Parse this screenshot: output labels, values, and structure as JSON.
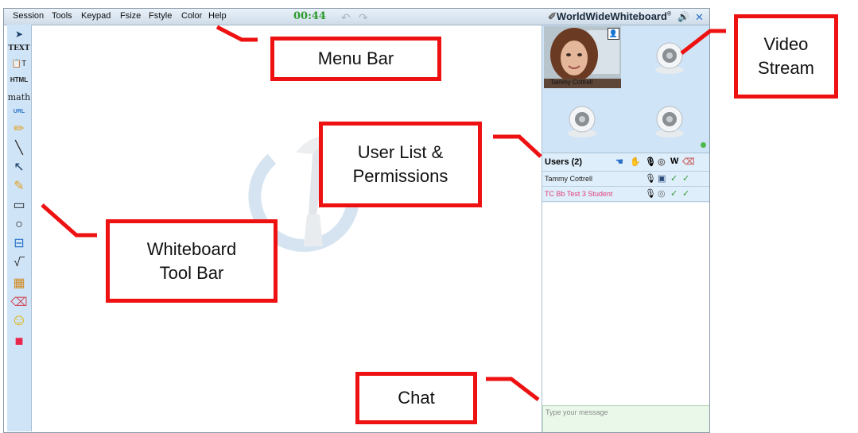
{
  "menu": {
    "items": [
      "Session",
      "Tools",
      "Keypad",
      "Fsize",
      "Fstyle",
      "Color",
      "Help"
    ],
    "timer": "00:44"
  },
  "brand": {
    "name": "WorldWideWhiteboard",
    "trademark": "®"
  },
  "toolbar": {
    "tools": [
      {
        "icon": "pointer-icon",
        "label": "➤"
      },
      {
        "icon": "text-tool-icon",
        "label": "TEXT"
      },
      {
        "icon": "paste-text-icon",
        "label": "📋T"
      },
      {
        "icon": "html-tool-icon",
        "label": "HTML"
      },
      {
        "icon": "math-tool-icon",
        "label": "math"
      },
      {
        "icon": "url-tool-icon",
        "label": "URL"
      },
      {
        "icon": "pencil-icon",
        "label": "✏"
      },
      {
        "icon": "line-tool-icon",
        "label": "╲"
      },
      {
        "icon": "arrow-tool-icon",
        "label": "↖"
      },
      {
        "icon": "highlighter-icon",
        "label": "✎"
      },
      {
        "icon": "rectangle-tool-icon",
        "label": "▭"
      },
      {
        "icon": "ellipse-tool-icon",
        "label": "○"
      },
      {
        "icon": "align-tool-icon",
        "label": "⊟"
      },
      {
        "icon": "sqrt-tool-icon",
        "label": "√‾"
      },
      {
        "icon": "insert-image-icon",
        "label": "▦"
      },
      {
        "icon": "eraser-icon",
        "label": "⌫"
      },
      {
        "icon": "smiley-icon",
        "label": "☺"
      },
      {
        "icon": "color-picker-icon",
        "label": "■"
      }
    ]
  },
  "video": {
    "main_caption": "Tammy Cottrell"
  },
  "users": {
    "header": "Users (2)",
    "header_icons": [
      "cursor-icon",
      "hand-raise-icon",
      "microphone-icon",
      "webcam-icon",
      "W",
      "eraser-permission-icon"
    ],
    "rows": [
      {
        "name": "Tammy Cottrell",
        "color": "#222222",
        "icons": [
          "microphone-icon",
          "video-icon",
          "✓",
          "✓"
        ]
      },
      {
        "name": "TC Bb Test 3 Student",
        "color": "#e0407a",
        "icons": [
          "microphone-icon",
          "webcam-icon",
          "✓",
          "✓"
        ]
      }
    ]
  },
  "chat": {
    "placeholder": "Type your message"
  },
  "annotations": {
    "menu_bar": "Menu Bar",
    "video_stream": "Video\nStream",
    "user_list": "User List &\nPermissions",
    "whiteboard_toolbar": "Whiteboard\nTool Bar",
    "chat": "Chat"
  },
  "colors": {
    "annotation_border": "#ee1111",
    "timer": "#2e9a2e",
    "panel_bg": "#cfe4f7",
    "student_name": "#e0407a",
    "chat_input_bg": "#e9f8e9"
  }
}
